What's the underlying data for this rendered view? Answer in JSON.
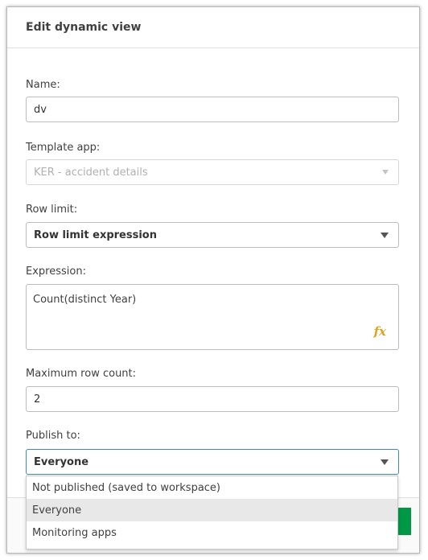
{
  "dialog": {
    "title": "Edit dynamic view"
  },
  "name": {
    "label": "Name:",
    "value": "dv"
  },
  "template_app": {
    "label": "Template app:",
    "value": "KER - accident details"
  },
  "row_limit": {
    "label": "Row limit:",
    "value": "Row limit expression"
  },
  "expression": {
    "label": "Expression:",
    "value": "Count(distinct Year)",
    "fx_icon": "fx-icon",
    "fx_text": "fx"
  },
  "max_row_count": {
    "label": "Maximum row count:",
    "value": "2"
  },
  "publish_to": {
    "label": "Publish to:",
    "value": "Everyone",
    "options": [
      "Not published (saved to workspace)",
      "Everyone",
      "Monitoring apps"
    ],
    "highlighted_index": 1
  },
  "colors": {
    "accent": "#009845",
    "fx": "#e0a31e",
    "focus_border": "#3f8ab4"
  }
}
